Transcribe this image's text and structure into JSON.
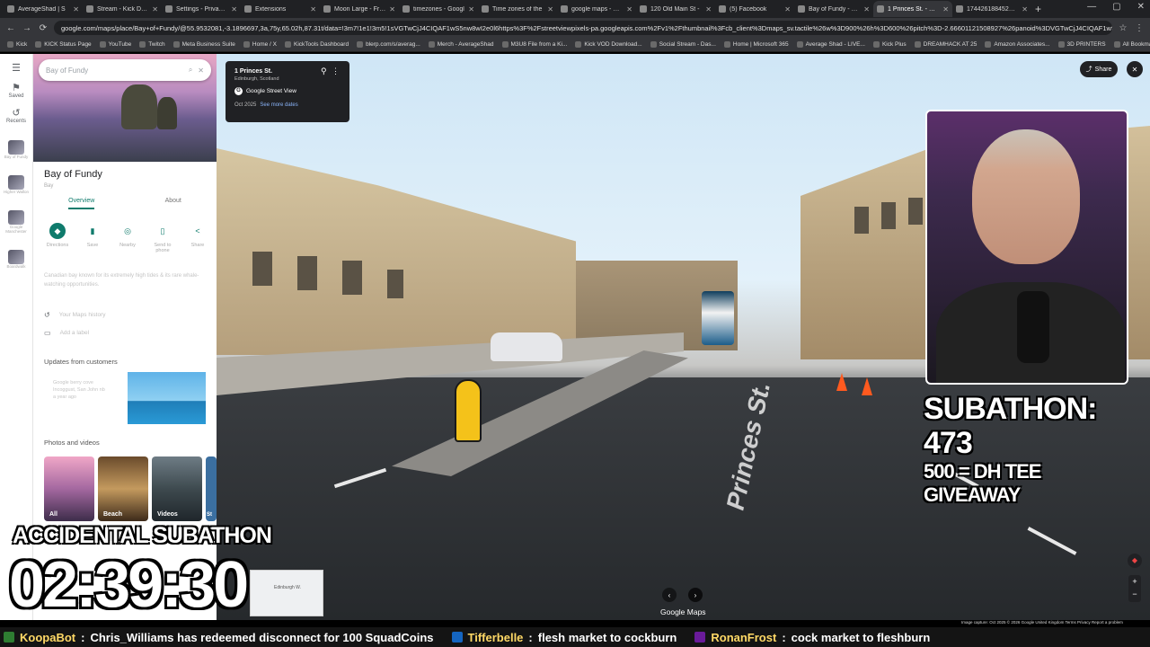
{
  "browser": {
    "tabs": [
      {
        "label": "AverageShad | S",
        "active": false
      },
      {
        "label": "Stream - Kick Dash",
        "active": false
      },
      {
        "label": "Settings - Privacy a",
        "active": false
      },
      {
        "label": "Extensions",
        "active": false
      },
      {
        "label": "Moon Large - Free",
        "active": false
      },
      {
        "label": "timezones - Googl",
        "active": false
      },
      {
        "label": "Time zones of the",
        "active": false
      },
      {
        "label": "google maps - Goo",
        "active": false
      },
      {
        "label": "120 Old Main St -",
        "active": false
      },
      {
        "label": "(5) Facebook",
        "active": false
      },
      {
        "label": "Bay of Fundy - Goo",
        "active": false
      },
      {
        "label": "1 Princes St. - Goo",
        "active": true
      },
      {
        "label": "1744261884521 (8",
        "active": false
      }
    ],
    "url": "google.com/maps/place/Bay+of+Fundy/@55.9532081,-3.1896697,3a,75y,65.02h,87.31t/data=!3m7!1e1!3m5!1sVGTwCjJ4CIQAF1wS5nw8wI2e0l6https%3F%2Fstreetviewpixels-pa.googleapis.com%2Fv1%2Fthumbnail%3Fcb_client%3Dmaps_sv.tactile%26w%3D900%26h%3D600%26pitch%3D-2.66601121508927%26panoid%3DVGTwCjJ4CIQAF1wS5nw8..."
  },
  "bookmarks": [
    "Kick",
    "KICK Status Page",
    "YouTube",
    "Twitch",
    "Meta Business Suite",
    "Home / X",
    "KickTools Dashboard",
    "blerp.com/s/averag...",
    "Merch - AverageShad",
    "M3U8 File from a Ki...",
    "Kick VOD Download...",
    "Social Stream - Das...",
    "Home | Microsoft 365",
    "Average Shad - LIVE...",
    "Kick Plus",
    "DREAMHACK AT 25",
    "Amazon Associates...",
    "3D PRINTERS",
    "All Bookmarks"
  ],
  "rail": {
    "saved": "Saved",
    "recents": "Recents",
    "thumbs": [
      "Bay of Fundy",
      "Higher Wallon",
      "Google Manchester",
      "Boardwalk"
    ]
  },
  "panel": {
    "search_value": "Bay of Fundy",
    "place_name": "Bay of Fundy",
    "place_type": "Bay",
    "tabs": [
      "Overview",
      "About"
    ],
    "actions": [
      "Directions",
      "Save",
      "Nearby",
      "Send to phone",
      "Share"
    ],
    "description": "Canadian bay known for its extremely high tides & its rare whale-watching opportunities.",
    "maps_history": "Your Maps history",
    "add_label": "Add a label",
    "updates_title": "Updates from customers",
    "update_text": "Google berry cove Incoggust, San John nb",
    "update_age": "a year ago",
    "photos_title": "Photos and videos",
    "photos": [
      "All",
      "Beach",
      "Videos",
      "St"
    ]
  },
  "streetview": {
    "address": "1 Princes St.",
    "city": "Edinburgh, Scotland",
    "source": "Google Street View",
    "date": "Oct 2025",
    "see_more": "See more dates",
    "street_label": "Princes St.",
    "share": "Share",
    "footer": "Google Maps",
    "credits": "Image capture: Oct 2025   © 2026 Google   United Kingdom   Terms   Privacy   Report a problem",
    "minimap_label": "Edinburgh W."
  },
  "overlay": {
    "subathon": "SUBATHON: 473",
    "giveaway": "500 = DH TEE GIVEAWAY",
    "accidental": "ACCIDENTAL SUBATHON",
    "timer": "02:39:30"
  },
  "ticker": [
    {
      "name": "KoopaBot",
      "text": "Chris_Williams has redeemed disconnect for 100 SquadCoins"
    },
    {
      "name": "Tifferbelle",
      "text": "flesh market to cockburn"
    },
    {
      "name": "RonanFrost",
      "text": "cock market to fleshburn"
    }
  ]
}
